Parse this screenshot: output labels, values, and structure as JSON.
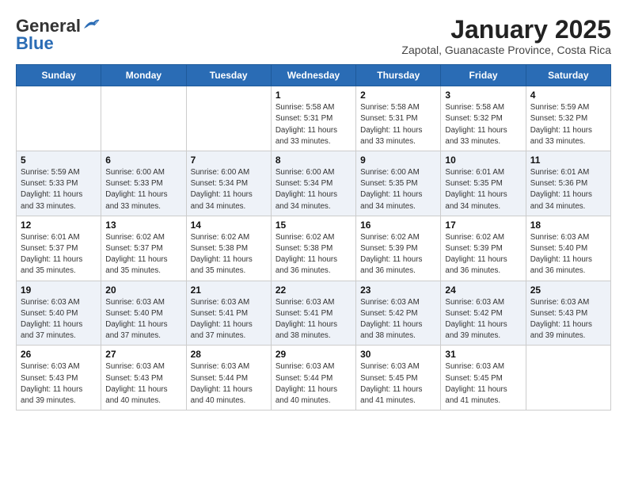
{
  "header": {
    "logo_line1": "General",
    "logo_line2": "Blue",
    "month_year": "January 2025",
    "location": "Zapotal, Guanacaste Province, Costa Rica"
  },
  "weekdays": [
    "Sunday",
    "Monday",
    "Tuesday",
    "Wednesday",
    "Thursday",
    "Friday",
    "Saturday"
  ],
  "weeks": [
    [
      {
        "day": "",
        "info": ""
      },
      {
        "day": "",
        "info": ""
      },
      {
        "day": "",
        "info": ""
      },
      {
        "day": "1",
        "info": "Sunrise: 5:58 AM\nSunset: 5:31 PM\nDaylight: 11 hours\nand 33 minutes."
      },
      {
        "day": "2",
        "info": "Sunrise: 5:58 AM\nSunset: 5:31 PM\nDaylight: 11 hours\nand 33 minutes."
      },
      {
        "day": "3",
        "info": "Sunrise: 5:58 AM\nSunset: 5:32 PM\nDaylight: 11 hours\nand 33 minutes."
      },
      {
        "day": "4",
        "info": "Sunrise: 5:59 AM\nSunset: 5:32 PM\nDaylight: 11 hours\nand 33 minutes."
      }
    ],
    [
      {
        "day": "5",
        "info": "Sunrise: 5:59 AM\nSunset: 5:33 PM\nDaylight: 11 hours\nand 33 minutes."
      },
      {
        "day": "6",
        "info": "Sunrise: 6:00 AM\nSunset: 5:33 PM\nDaylight: 11 hours\nand 33 minutes."
      },
      {
        "day": "7",
        "info": "Sunrise: 6:00 AM\nSunset: 5:34 PM\nDaylight: 11 hours\nand 34 minutes."
      },
      {
        "day": "8",
        "info": "Sunrise: 6:00 AM\nSunset: 5:34 PM\nDaylight: 11 hours\nand 34 minutes."
      },
      {
        "day": "9",
        "info": "Sunrise: 6:00 AM\nSunset: 5:35 PM\nDaylight: 11 hours\nand 34 minutes."
      },
      {
        "day": "10",
        "info": "Sunrise: 6:01 AM\nSunset: 5:35 PM\nDaylight: 11 hours\nand 34 minutes."
      },
      {
        "day": "11",
        "info": "Sunrise: 6:01 AM\nSunset: 5:36 PM\nDaylight: 11 hours\nand 34 minutes."
      }
    ],
    [
      {
        "day": "12",
        "info": "Sunrise: 6:01 AM\nSunset: 5:37 PM\nDaylight: 11 hours\nand 35 minutes."
      },
      {
        "day": "13",
        "info": "Sunrise: 6:02 AM\nSunset: 5:37 PM\nDaylight: 11 hours\nand 35 minutes."
      },
      {
        "day": "14",
        "info": "Sunrise: 6:02 AM\nSunset: 5:38 PM\nDaylight: 11 hours\nand 35 minutes."
      },
      {
        "day": "15",
        "info": "Sunrise: 6:02 AM\nSunset: 5:38 PM\nDaylight: 11 hours\nand 36 minutes."
      },
      {
        "day": "16",
        "info": "Sunrise: 6:02 AM\nSunset: 5:39 PM\nDaylight: 11 hours\nand 36 minutes."
      },
      {
        "day": "17",
        "info": "Sunrise: 6:02 AM\nSunset: 5:39 PM\nDaylight: 11 hours\nand 36 minutes."
      },
      {
        "day": "18",
        "info": "Sunrise: 6:03 AM\nSunset: 5:40 PM\nDaylight: 11 hours\nand 36 minutes."
      }
    ],
    [
      {
        "day": "19",
        "info": "Sunrise: 6:03 AM\nSunset: 5:40 PM\nDaylight: 11 hours\nand 37 minutes."
      },
      {
        "day": "20",
        "info": "Sunrise: 6:03 AM\nSunset: 5:40 PM\nDaylight: 11 hours\nand 37 minutes."
      },
      {
        "day": "21",
        "info": "Sunrise: 6:03 AM\nSunset: 5:41 PM\nDaylight: 11 hours\nand 37 minutes."
      },
      {
        "day": "22",
        "info": "Sunrise: 6:03 AM\nSunset: 5:41 PM\nDaylight: 11 hours\nand 38 minutes."
      },
      {
        "day": "23",
        "info": "Sunrise: 6:03 AM\nSunset: 5:42 PM\nDaylight: 11 hours\nand 38 minutes."
      },
      {
        "day": "24",
        "info": "Sunrise: 6:03 AM\nSunset: 5:42 PM\nDaylight: 11 hours\nand 39 minutes."
      },
      {
        "day": "25",
        "info": "Sunrise: 6:03 AM\nSunset: 5:43 PM\nDaylight: 11 hours\nand 39 minutes."
      }
    ],
    [
      {
        "day": "26",
        "info": "Sunrise: 6:03 AM\nSunset: 5:43 PM\nDaylight: 11 hours\nand 39 minutes."
      },
      {
        "day": "27",
        "info": "Sunrise: 6:03 AM\nSunset: 5:43 PM\nDaylight: 11 hours\nand 40 minutes."
      },
      {
        "day": "28",
        "info": "Sunrise: 6:03 AM\nSunset: 5:44 PM\nDaylight: 11 hours\nand 40 minutes."
      },
      {
        "day": "29",
        "info": "Sunrise: 6:03 AM\nSunset: 5:44 PM\nDaylight: 11 hours\nand 40 minutes."
      },
      {
        "day": "30",
        "info": "Sunrise: 6:03 AM\nSunset: 5:45 PM\nDaylight: 11 hours\nand 41 minutes."
      },
      {
        "day": "31",
        "info": "Sunrise: 6:03 AM\nSunset: 5:45 PM\nDaylight: 11 hours\nand 41 minutes."
      },
      {
        "day": "",
        "info": ""
      }
    ]
  ]
}
